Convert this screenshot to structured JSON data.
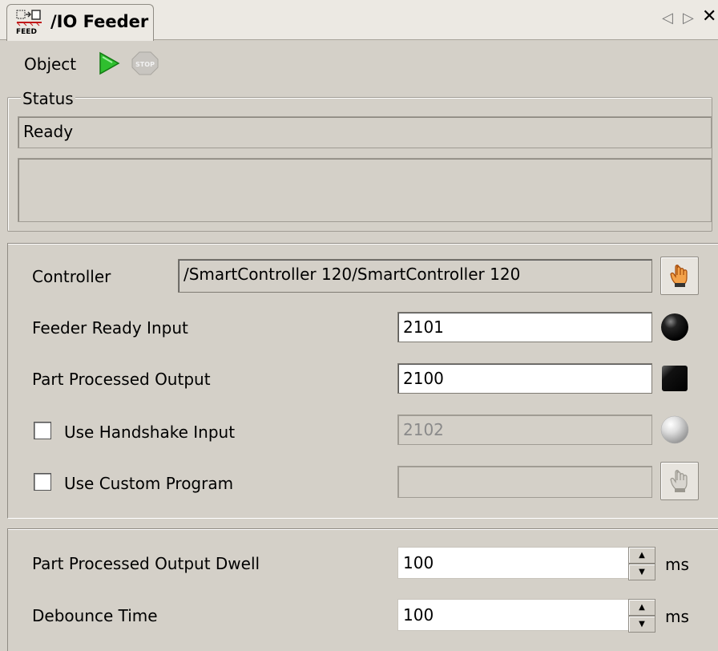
{
  "tab": {
    "title": "/IO Feeder",
    "icon_label": "FEED"
  },
  "toolbar": {
    "object_label": "Object",
    "stop_icon_label": "STOP"
  },
  "status": {
    "legend": "Status",
    "text": "Ready",
    "detail": ""
  },
  "controller": {
    "label": "Controller",
    "value": "/SmartController 120/SmartController 120"
  },
  "feeder_ready_input": {
    "label": "Feeder Ready Input",
    "value": "2101"
  },
  "part_processed_output": {
    "label": "Part Processed Output",
    "value": "2100"
  },
  "use_handshake_input": {
    "label": "Use Handshake Input",
    "checked": false,
    "value": "2102"
  },
  "use_custom_program": {
    "label": "Use Custom Program",
    "checked": false,
    "value": ""
  },
  "part_processed_output_dwell": {
    "label": "Part Processed Output Dwell",
    "value": "100",
    "unit": "ms"
  },
  "debounce_time": {
    "label": "Debounce Time",
    "value": "100",
    "unit": "ms"
  },
  "colors": {
    "background": "#d4d0c8",
    "play_green": "#2fbf2f",
    "pointer_orange": "#e8741e"
  }
}
